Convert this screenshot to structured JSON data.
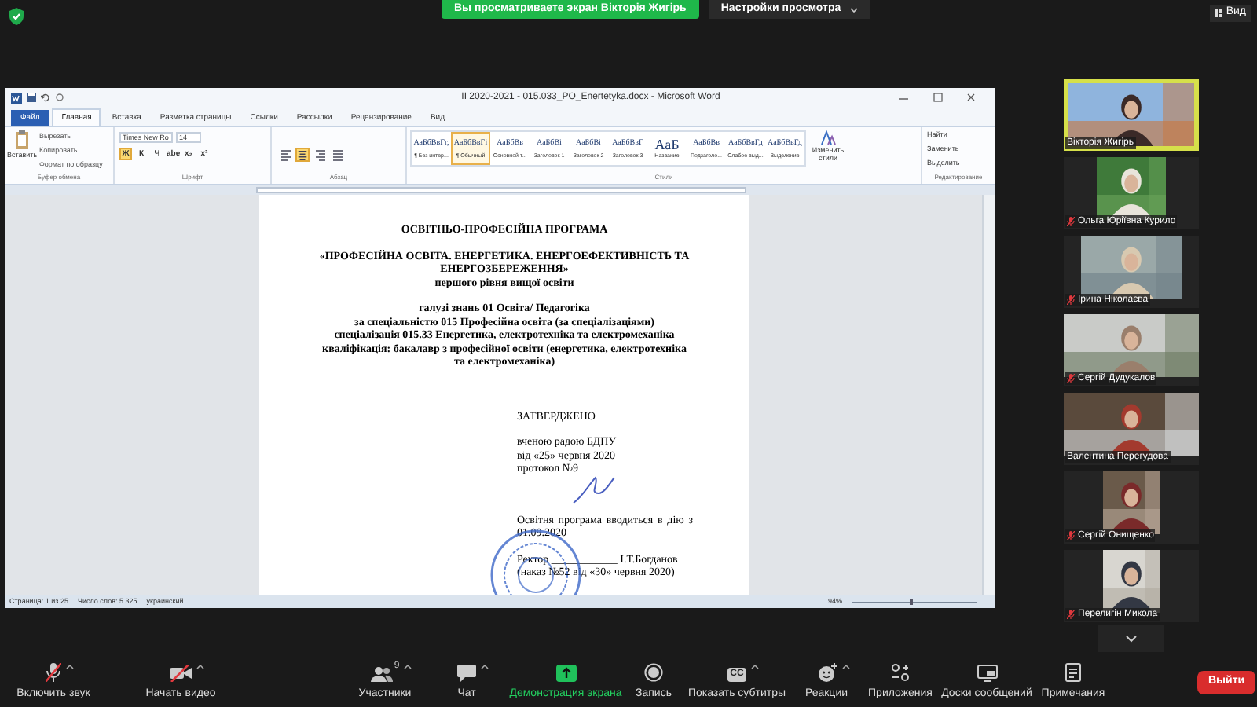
{
  "top_bar": {
    "banner": "Вы просматриваете экран Вікторія Жигірь",
    "view_settings": "Настройки просмотра",
    "view_button": "Вид"
  },
  "word": {
    "title": "ІІ 2020-2021 - 015.033_PO_Enertetyka.docx - Microsoft Word",
    "tabs": [
      {
        "label": "Файл",
        "kind": "file",
        "selected": false
      },
      {
        "label": "Главная",
        "kind": "tab",
        "selected": true
      },
      {
        "label": "Вставка",
        "kind": "tab",
        "selected": false
      },
      {
        "label": "Разметка страницы",
        "kind": "tab",
        "selected": false
      },
      {
        "label": "Ссылки",
        "kind": "tab",
        "selected": false
      },
      {
        "label": "Рассылки",
        "kind": "tab",
        "selected": false
      },
      {
        "label": "Рецензирование",
        "kind": "tab",
        "selected": false
      },
      {
        "label": "Вид",
        "kind": "tab",
        "selected": false
      }
    ],
    "ribbon": {
      "clipboard": {
        "paste": "Вставить",
        "commands": [
          "Вырезать",
          "Копировать",
          "Формат по образцу"
        ],
        "label": "Буфер обмена"
      },
      "font": {
        "family": "Times New Ro",
        "size": "14",
        "formats": [
          {
            "label": "Ж",
            "selected": true
          },
          {
            "label": "К",
            "selected": false
          },
          {
            "label": "Ч",
            "selected": false
          },
          {
            "label": "abe",
            "selected": false
          },
          {
            "label": "x₂",
            "selected": false
          },
          {
            "label": "x²",
            "selected": false
          }
        ],
        "label": "Шрифт"
      },
      "paragraph": {
        "alignments": [
          {
            "selected": false
          },
          {
            "selected": true
          },
          {
            "selected": false
          },
          {
            "selected": false
          }
        ],
        "label": "Абзац"
      },
      "styles": {
        "items": [
          {
            "preview": "АаБбВвГг,",
            "name": "¶ Без интер...",
            "selected": false
          },
          {
            "preview": "АаБбВвГі",
            "name": "¶ Обычный",
            "selected": true
          },
          {
            "preview": "АаБбВв",
            "name": "Основной т...",
            "selected": false
          },
          {
            "preview": "АаБбВі",
            "name": "Заголовок 1",
            "selected": false
          },
          {
            "preview": "АаБбВі",
            "name": "Заголовок 2",
            "selected": false
          },
          {
            "preview": "АаБбВвГ",
            "name": "Заголовок 3",
            "selected": false
          },
          {
            "preview": "АаБ",
            "name": "Название",
            "selected": false
          },
          {
            "preview": "АаБбВв",
            "name": "Подзаголо...",
            "selected": false
          },
          {
            "preview": "АаБбВвГд",
            "name": "Слабое выд...",
            "selected": false
          },
          {
            "preview": "АаБбВвГд",
            "name": "Выделение",
            "selected": false
          }
        ],
        "change": "Изменить стили",
        "label": "Стили"
      },
      "editing": {
        "commands": [
          "Найти",
          "Заменить",
          "Выделить"
        ],
        "label": "Редактирование"
      }
    },
    "document": {
      "blocks": [
        {
          "kind": "heading",
          "lines": [
            "ОСВІТНЬО-ПРОФЕСІЙНА ПРОГРАМА"
          ]
        },
        {
          "kind": "center",
          "lines": [
            "«ПРОФЕСІЙНА ОСВІТА.  ЕНЕРГЕТИКА. ЕНЕРГОЕФЕКТИВНІСТЬ ТА ЕНЕРГОЗБЕРЕЖЕННЯ»",
            "першого рівня вищої освіти"
          ]
        },
        {
          "kind": "center",
          "lines": [
            "галузі знань 01 Освіта/ Педагогіка",
            "за спеціальністю 015 Професійна освіта (за спеціалізаціями)",
            "спеціалізація 015.33 Енергетика, електротехніка та електромеханіка",
            "кваліфікація: бакалавр з професійної освіти (енергетика, електротехніка та електромеханіка)"
          ]
        },
        {
          "kind": "approval",
          "lines": [
            "ЗАТВЕРДЖЕНО"
          ]
        },
        {
          "kind": "right",
          "lines": [
            "вченою радою БДПУ",
            "від «25» червня 2020",
            "протокол №9"
          ]
        },
        {
          "kind": "justified",
          "lines": [
            "Освітня програма вводиться в дію з 01.09.2020"
          ]
        },
        {
          "kind": "right",
          "lines": [
            "Ректор ____________ І.Т.Богданов",
            "(наказ №52 від «30» червня 2020)"
          ]
        }
      ]
    },
    "status": {
      "page": "Страница: 1 из 25",
      "words": "Число слов: 5 325",
      "language": "украинский",
      "zoom": "94%",
      "zoom_slider": {
        "level": 0.47
      }
    }
  },
  "participants": [
    {
      "name": "Вікторія Жигірь",
      "muted": false,
      "active": true
    },
    {
      "name": "Ольга Юріївна Курило",
      "muted": true,
      "active": false
    },
    {
      "name": "Ірина Ніколаєва",
      "muted": true,
      "active": false
    },
    {
      "name": "Сергій Дудукалов",
      "muted": true,
      "active": false
    },
    {
      "name": "Валентина Перегудова",
      "muted": false,
      "active": false
    },
    {
      "name": "Сергій Онищенко",
      "muted": true,
      "active": false
    },
    {
      "name": "Перелигін Микола",
      "muted": true,
      "active": false
    }
  ],
  "toolbar": {
    "items": [
      {
        "kind": "mic",
        "label": "Включить звук",
        "caret": true
      },
      {
        "kind": "video",
        "label": "Начать видео",
        "caret": true
      },
      {
        "kind": "participants",
        "label": "Участники",
        "count": "9",
        "caret": true
      },
      {
        "kind": "chat",
        "label": "Чат",
        "caret": true
      },
      {
        "kind": "share",
        "label": "Демонстрация экрана",
        "caret": false
      },
      {
        "kind": "record",
        "label": "Запись",
        "caret": false
      },
      {
        "kind": "cc",
        "label": "Показать субтитры",
        "icon_text": "CC",
        "caret": true
      },
      {
        "kind": "reactions",
        "label": "Реакции",
        "caret": true
      },
      {
        "kind": "apps",
        "label": "Приложения",
        "caret": false
      },
      {
        "kind": "boards",
        "label": "Доски сообщений",
        "caret": false
      },
      {
        "kind": "notes",
        "label": "Примечания",
        "caret": false
      }
    ],
    "leave": "Выйти"
  }
}
